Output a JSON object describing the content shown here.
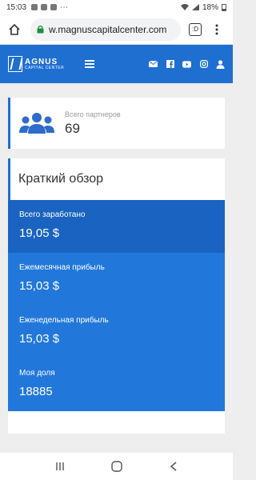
{
  "status_bar": {
    "time": "15:03",
    "battery": "18%"
  },
  "browser": {
    "url": "w.magnuscapitalcenter.com",
    "tab_count": ":D"
  },
  "site_header": {
    "logo_title": "AGNUS",
    "logo_subtitle": "CAPITAL CENTER",
    "accent_color": "#1f6fd1",
    "social_icons": [
      "mail-icon",
      "facebook-icon",
      "youtube-icon",
      "instagram-icon",
      "user-icon"
    ]
  },
  "partners": {
    "label": "Всего партнеров",
    "value": "69"
  },
  "overview": {
    "title": "Краткий обзор",
    "stats": [
      {
        "label": "Всего заработано",
        "value": "19,05 $"
      },
      {
        "label": "Ежемесячная прибыль",
        "value": "15,03 $"
      },
      {
        "label": "Еженедельная прибыль",
        "value": "15,03 $"
      },
      {
        "label": "Моя доля",
        "value": "18885"
      }
    ]
  }
}
